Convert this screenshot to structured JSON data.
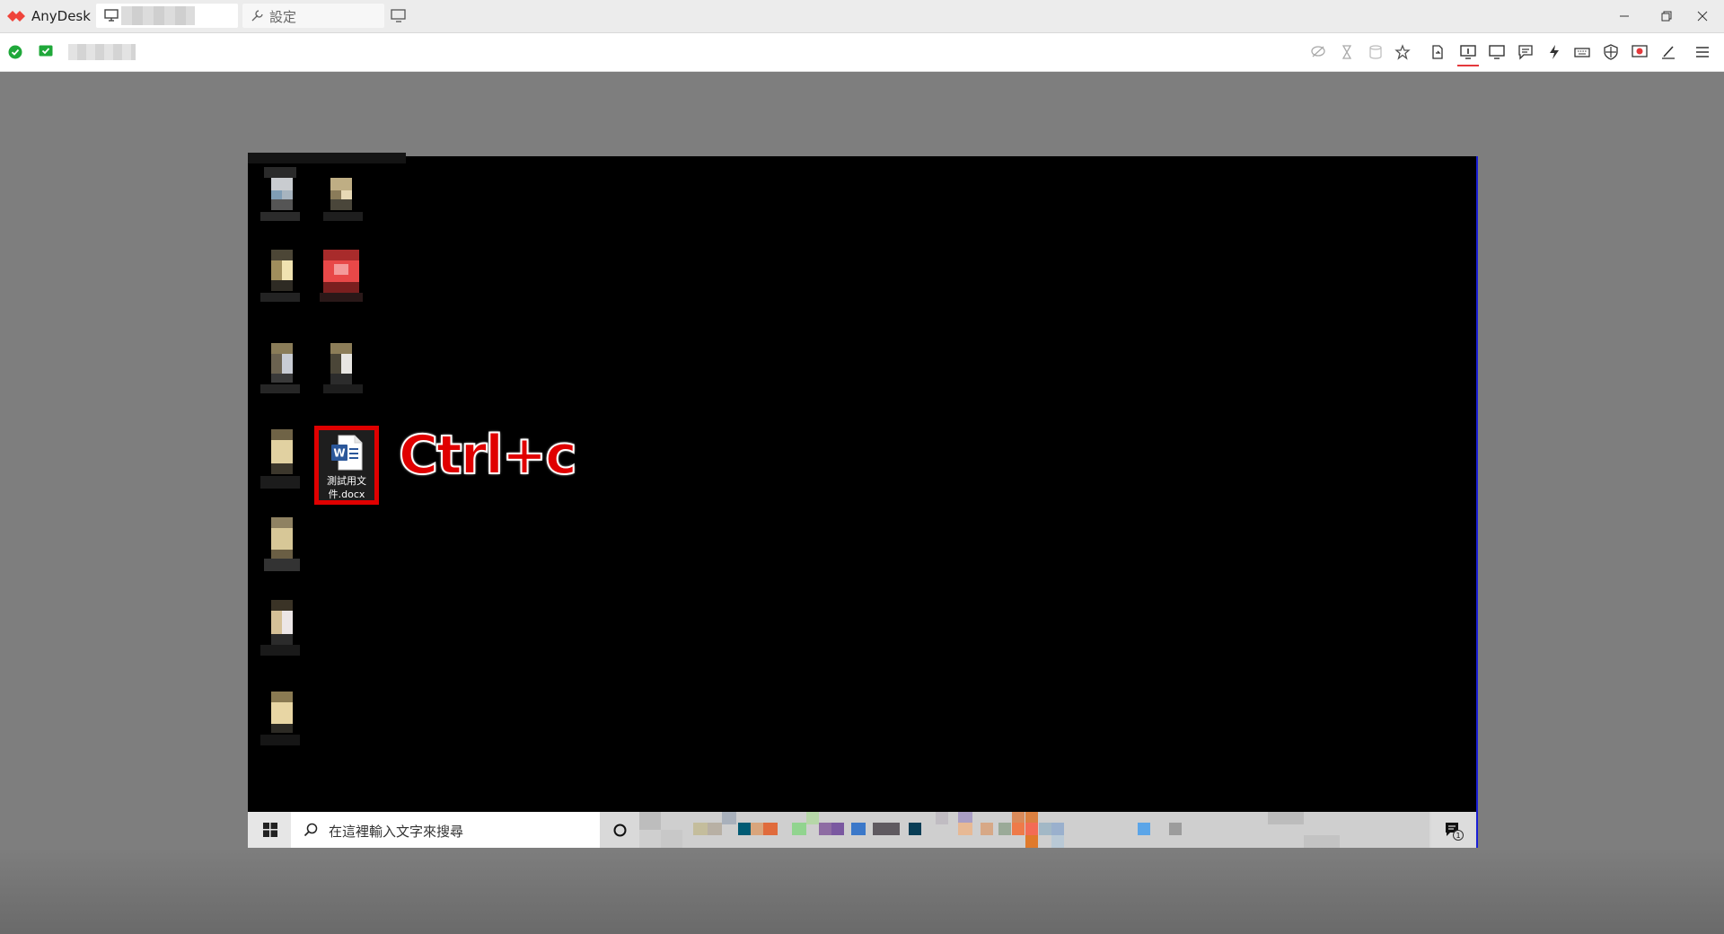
{
  "titlebar": {
    "app_name": "AnyDesk",
    "tabs": [
      {
        "label": "",
        "icon": "monitor-icon"
      },
      {
        "label": "設定",
        "icon": "wrench-icon"
      }
    ]
  },
  "toolbar": {
    "status_icons": [
      "check-circle-icon",
      "check-badge-icon"
    ],
    "right_icons": [
      "chat-off-icon",
      "hourglass-icon",
      "database-icon",
      "star-icon",
      "file-transfer-icon",
      "monitor-select-icon",
      "display-icon",
      "chat-icon",
      "action-icon",
      "keyboard-icon",
      "privacy-icon",
      "record-icon",
      "whiteboard-icon",
      "menu-icon"
    ],
    "active_icon": "monitor-select-icon"
  },
  "remote": {
    "file_name": "測試用文件.docx",
    "shortcut_annotation": "Ctrl+c",
    "taskbar": {
      "search_placeholder": "在這裡輸入文字來搜尋",
      "notification_count": "1"
    }
  },
  "colors": {
    "brand": "#ef443b",
    "annotation": "#e00000",
    "screen_border": "#1a1fd6"
  }
}
